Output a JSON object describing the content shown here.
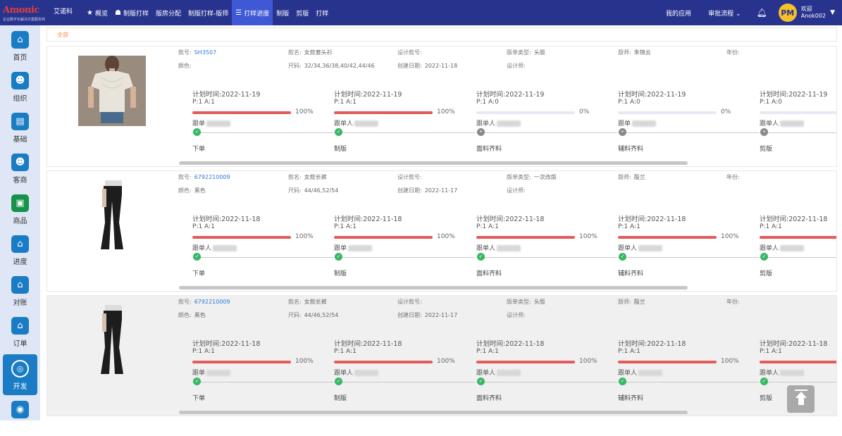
{
  "app": {
    "brand": "Amonic",
    "brand_cn": "艾诺科",
    "tagline": "企业数字化解决方案服务商"
  },
  "nav": [
    {
      "label": "概览",
      "icon": "★"
    },
    {
      "label": "制版打样",
      "icon": "☗"
    },
    {
      "label": "版房分配",
      "icon": ""
    },
    {
      "label": "制版打样-版师",
      "icon": ""
    },
    {
      "label": "打样进度",
      "icon": "☰",
      "active": true
    },
    {
      "label": "制版",
      "icon": ""
    },
    {
      "label": "剪版",
      "icon": ""
    },
    {
      "label": "打样",
      "icon": ""
    }
  ],
  "top_right": {
    "my_apps": "我的应用",
    "approval": "审批流程",
    "avatar": "PM",
    "welcome": "欢迎",
    "username": "Anok002"
  },
  "sidebar": [
    {
      "label": "首页",
      "icon": "⌂"
    },
    {
      "label": "组织",
      "icon": "☻"
    },
    {
      "label": "基础",
      "icon": "▤"
    },
    {
      "label": "客商",
      "icon": "☻"
    },
    {
      "label": "商品",
      "icon": "▣"
    },
    {
      "label": "进度",
      "icon": "⌂"
    },
    {
      "label": "对账",
      "icon": "⌂"
    },
    {
      "label": "订单",
      "icon": "⌂"
    },
    {
      "label": "开发",
      "icon": "◎",
      "active": true
    },
    {
      "label": "",
      "icon": "◉"
    }
  ],
  "filter": {
    "all_label": "全部"
  },
  "labels": {
    "no": "款号:",
    "name": "款名:",
    "design_no": "设计款号:",
    "type": "版单类型:",
    "pattern_maker": "版师:",
    "year": "年份:",
    "color": "颜色:",
    "size": "尺码:",
    "created": "创建日期:",
    "designer": "设计师:"
  },
  "cards": [
    {
      "no": "SH3507",
      "name": "女款套头衫",
      "design_no": "",
      "type": "头版",
      "pattern_maker": "朱锦云",
      "year": "",
      "color": "",
      "size": "32/34,36/38,40/42,44/46",
      "created": "2022-11-18",
      "designer": "",
      "stages": [
        {
          "plan": "计划时间:2022-11-19",
          "pa": "P:1 A:1",
          "progress": 100,
          "pct": "100%",
          "follower": "跟单",
          "step": "下单",
          "done": true
        },
        {
          "plan": "计划时间:2022-11-19",
          "pa": "P:1 A:1",
          "progress": 100,
          "pct": "100%",
          "follower": "跟单人",
          "step": "制版",
          "done": true
        },
        {
          "plan": "计划时间:2022-11-19",
          "pa": "P:1 A:0",
          "progress": 0,
          "pct": "0%",
          "follower": "跟单人",
          "step": "面料齐料",
          "done": false
        },
        {
          "plan": "计划时间:2022-11-19",
          "pa": "P:1 A:0",
          "progress": 0,
          "pct": "0%",
          "follower": "跟单",
          "step": "辅料齐料",
          "done": false
        },
        {
          "plan": "计划时间:2022-11-19",
          "pa": "P:1 A:0",
          "progress": 0,
          "pct": "",
          "follower": "跟单人",
          "step": "剪版",
          "done": false
        }
      ]
    },
    {
      "no": "6792210009",
      "name": "女款长裤",
      "design_no": "",
      "type": "一次改版",
      "pattern_maker": "殷兰",
      "year": "",
      "color": "黑色",
      "size": "44/46,52/54",
      "created": "2022-11-17",
      "designer": "",
      "stages": [
        {
          "plan": "计划时间:2022-11-18",
          "pa": "P:1 A:1",
          "progress": 100,
          "pct": "100%",
          "follower": "跟单人",
          "step": "下单",
          "done": true
        },
        {
          "plan": "计划时间:2022-11-18",
          "pa": "P:1 A:1",
          "progress": 100,
          "pct": "100%",
          "follower": "跟单",
          "step": "制版",
          "done": true
        },
        {
          "plan": "计划时间:2022-11-18",
          "pa": "P:1 A:1",
          "progress": 100,
          "pct": "100%",
          "follower": "跟单人",
          "step": "面料齐料",
          "done": true
        },
        {
          "plan": "计划时间:2022-11-18",
          "pa": "P:1 A:1",
          "progress": 100,
          "pct": "100%",
          "follower": "跟单人",
          "step": "辅料齐料",
          "done": true
        },
        {
          "plan": "计划时间:2022-11-18",
          "pa": "P:1 A:1",
          "progress": 100,
          "pct": "",
          "follower": "跟单人",
          "step": "剪版",
          "done": true
        }
      ]
    },
    {
      "no": "6792210009",
      "name": "女款长裤",
      "design_no": "",
      "type": "头版",
      "pattern_maker": "殷兰",
      "year": "",
      "color": "黑色",
      "size": "44/46,52/54",
      "created": "2022-11-17",
      "designer": "",
      "stages": [
        {
          "plan": "计划时间:2022-11-18",
          "pa": "P:1 A:1",
          "progress": 100,
          "pct": "100%",
          "follower": "跟单",
          "step": "下单",
          "done": true
        },
        {
          "plan": "计划时间:2022-11-18",
          "pa": "P:1 A:1",
          "progress": 100,
          "pct": "100%",
          "follower": "跟单人",
          "step": "制版",
          "done": true
        },
        {
          "plan": "计划时间:2022-11-18",
          "pa": "P:1 A:1",
          "progress": 100,
          "pct": "100%",
          "follower": "跟单人",
          "step": "面料齐料",
          "done": true
        },
        {
          "plan": "计划时间:2022-11-18",
          "pa": "P:1 A:1",
          "progress": 100,
          "pct": "100%",
          "follower": "跟单人",
          "step": "辅料齐料",
          "done": true
        },
        {
          "plan": "计划时间:2022-11-18",
          "pa": "P:1 A:1",
          "progress": 100,
          "pct": "",
          "follower": "跟单人",
          "step": "剪版",
          "done": true
        }
      ]
    }
  ]
}
